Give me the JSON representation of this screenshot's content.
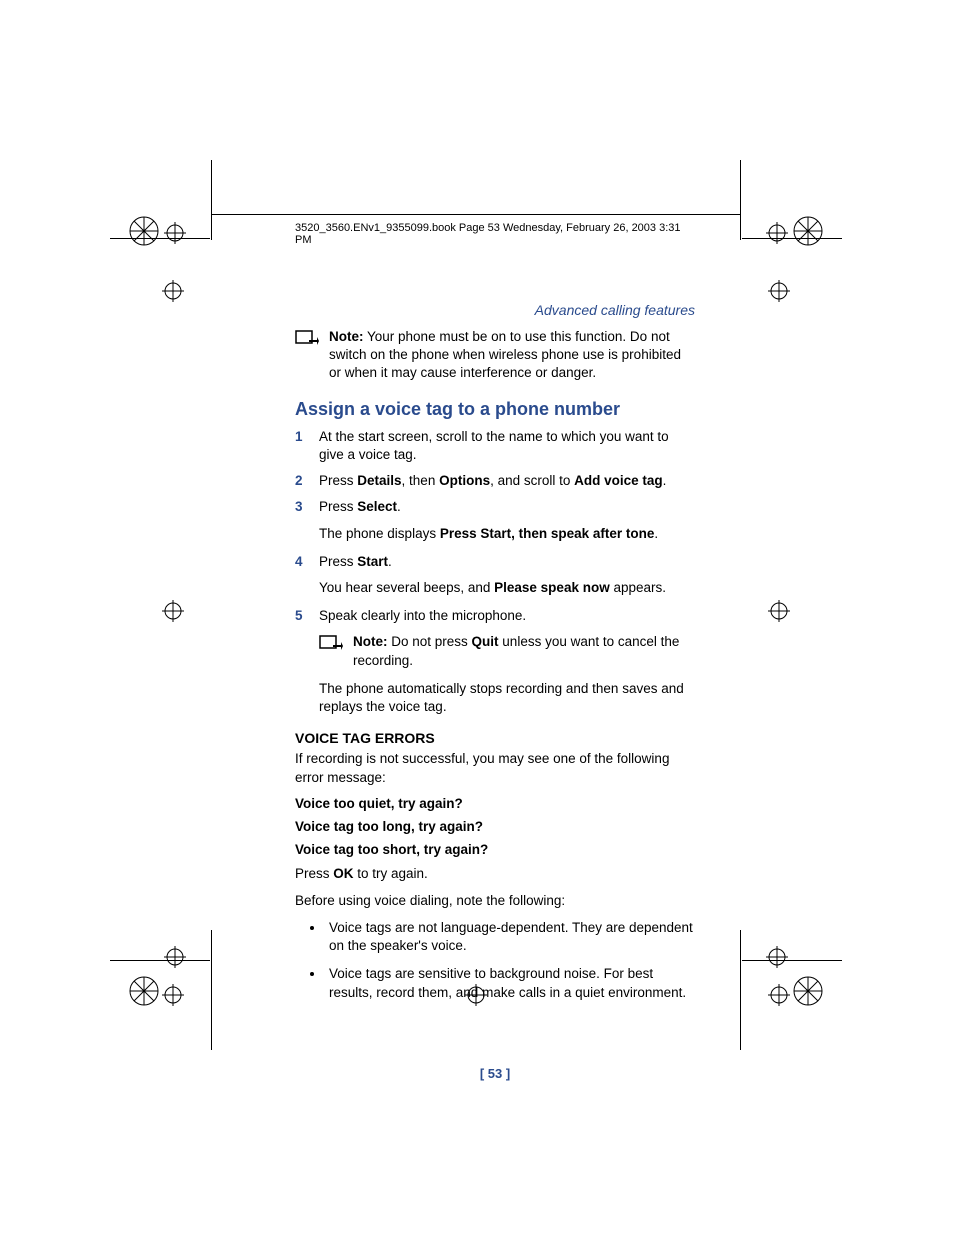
{
  "book_header": "3520_3560.ENv1_9355099.book  Page 53  Wednesday, February 26, 2003  3:31 PM",
  "section_header": "Advanced calling features",
  "note1_label": "Note:",
  "note1_text": " Your phone must be on to use this function. Do not switch on the phone when wireless phone use is prohibited or when it may cause interference or danger.",
  "title": "Assign a voice tag to a phone number",
  "steps": {
    "s1_num": "1",
    "s1": "At the start screen, scroll to the name to which you want to give a voice tag.",
    "s2_num": "2",
    "s2_a": "Press ",
    "s2_b": "Details",
    "s2_c": ", then ",
    "s2_d": "Options",
    "s2_e": ", and scroll to ",
    "s2_f": "Add voice tag",
    "s2_g": ".",
    "s3_num": "3",
    "s3_a": "Press ",
    "s3_b": "Select",
    "s3_c": ".",
    "s3_follow_a": "The phone displays ",
    "s3_follow_b": "Press Start, then speak after tone",
    "s3_follow_c": ".",
    "s4_num": "4",
    "s4_a": "Press ",
    "s4_b": "Start",
    "s4_c": ".",
    "s4_follow_a": "You hear several beeps, and ",
    "s4_follow_b": "Please speak now",
    "s4_follow_c": " appears.",
    "s5_num": "5",
    "s5": "Speak clearly into the microphone."
  },
  "note2_label": "Note:",
  "note2_a": " Do not press ",
  "note2_b": "Quit",
  "note2_c": " unless you want to cancel the recording.",
  "post_note": "The phone automatically stops recording and then saves and replays the voice tag.",
  "errors_heading": "VOICE TAG ERRORS",
  "errors_intro": "If recording is not successful, you may see one of the following error message:",
  "err1": "Voice too quiet, try again?",
  "err2": "Voice tag too long, try again?",
  "err3": "Voice tag too short, try again?",
  "press_ok_a": "Press ",
  "press_ok_b": "OK",
  "press_ok_c": " to try again.",
  "before_using": "Before using voice dialing, note the following:",
  "bullet1": "Voice tags are not language-dependent. They are dependent on the speaker's voice.",
  "bullet2": "Voice tags are sensitive to background noise. For best results, record them, and make calls in a quiet environment.",
  "page_number": "[ 53 ]"
}
